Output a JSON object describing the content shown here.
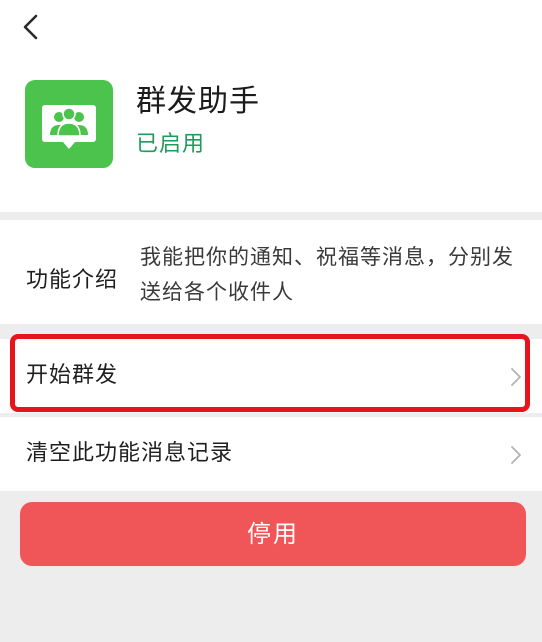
{
  "nav": {
    "back_icon": "back-chevron-icon"
  },
  "app": {
    "name": "群发助手",
    "status": "已启用",
    "status_color": "#1e9c5a",
    "icon_name": "group-chat-icon",
    "icon_color": "#4bc34d"
  },
  "intro": {
    "label": "功能介绍",
    "description": "我能把你的通知、祝福等消息，分别发送给各个收件人"
  },
  "actions": [
    {
      "label": "开始群发",
      "chevron": "chevron-right-icon",
      "highlighted": true
    },
    {
      "label": "清空此功能消息记录",
      "chevron": "chevron-right-icon",
      "highlighted": false
    }
  ],
  "disable_button": {
    "label": "停用",
    "color": "#f05657"
  },
  "highlight_color": "#e8141c"
}
